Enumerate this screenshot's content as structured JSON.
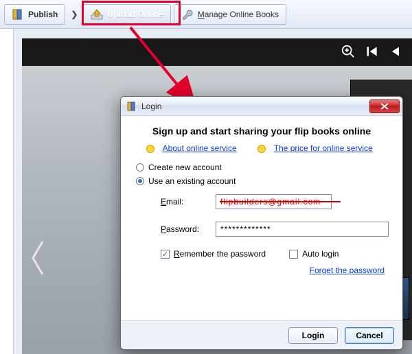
{
  "toolbar": {
    "publish_label": "Publish",
    "upload_label": "Upload Online",
    "manage_label": "Manage Online Books"
  },
  "player": {
    "zoom_icon": "zoom-in",
    "first_icon": "first-page",
    "prev_icon": "prev-page"
  },
  "dialog": {
    "title": "Login",
    "heading": "Sign up and start sharing your flip books online",
    "link_about": "About online service",
    "link_price": "The price for online service",
    "radio_create": "Create new account",
    "radio_existing": "Use an existing account",
    "email_label": "Email:",
    "email_value": "flipbuilders@gmail.com",
    "password_label": "Password:",
    "password_value": "*************",
    "remember_label": "Remember the password",
    "autologin_label": "Auto login",
    "forget_label": "Forget the password",
    "login_btn": "Login",
    "cancel_btn": "Cancel"
  }
}
